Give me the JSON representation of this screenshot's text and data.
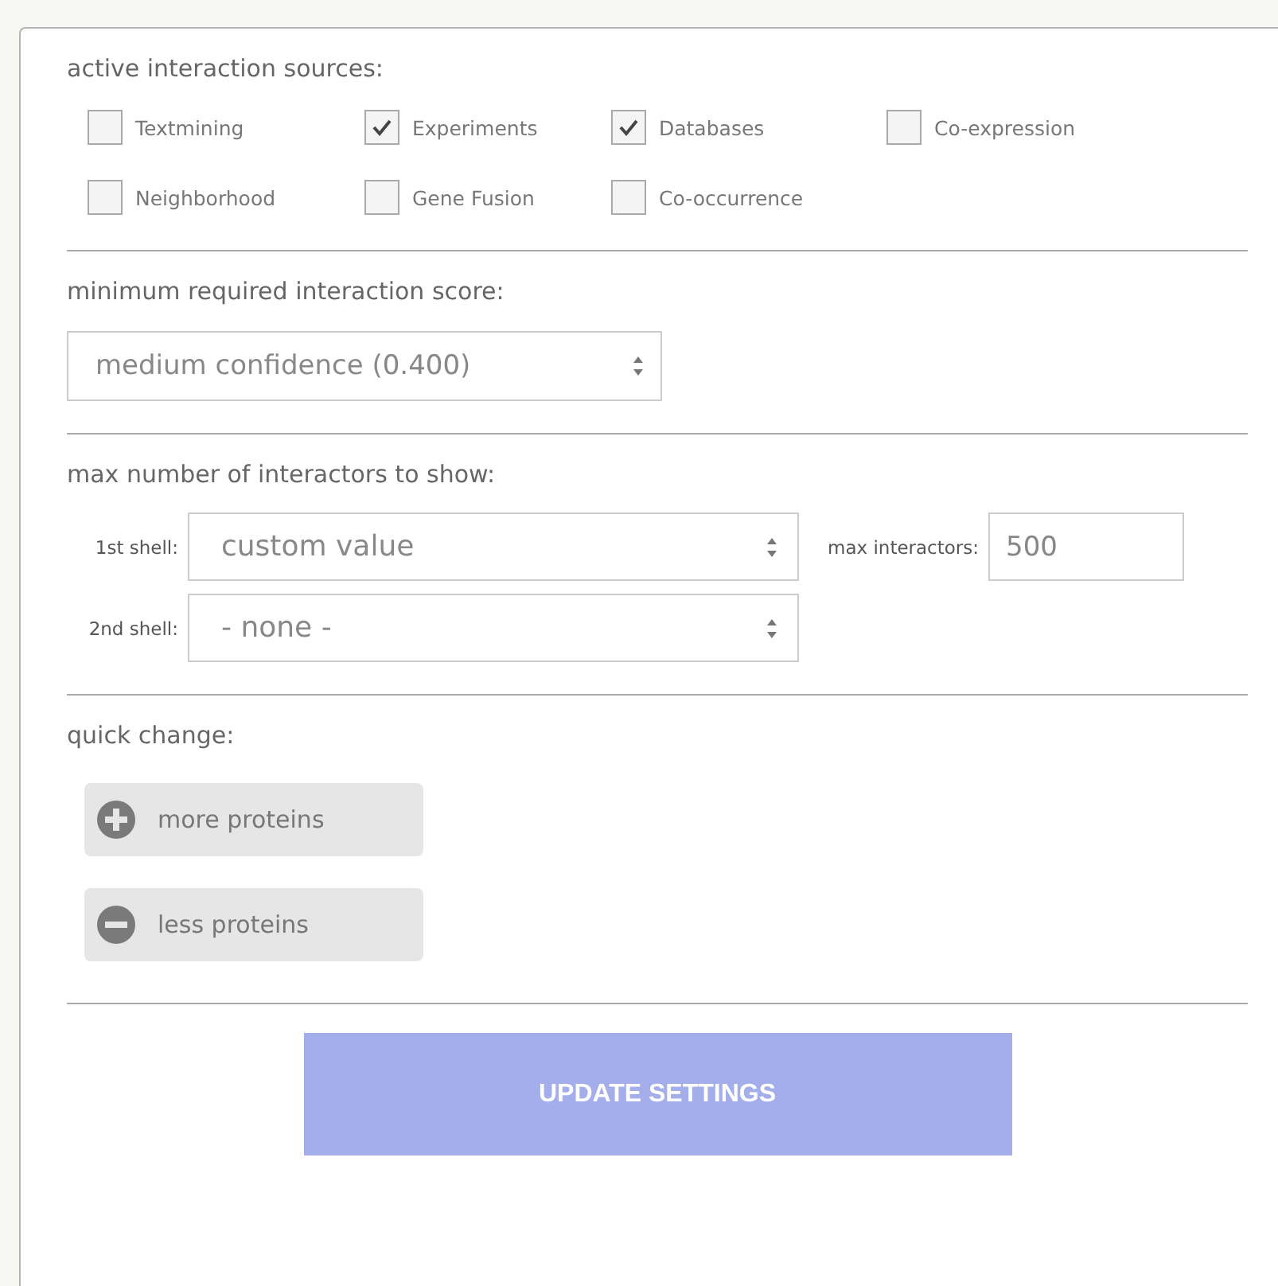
{
  "sources": {
    "heading": "active interaction sources:",
    "items": [
      {
        "label": "Textmining",
        "checked": false
      },
      {
        "label": "Experiments",
        "checked": true
      },
      {
        "label": "Databases",
        "checked": true
      },
      {
        "label": "Co-expression",
        "checked": false
      },
      {
        "label": "Neighborhood",
        "checked": false
      },
      {
        "label": "Gene Fusion",
        "checked": false
      },
      {
        "label": "Co-occurrence",
        "checked": false
      }
    ]
  },
  "score": {
    "heading": "minimum required interaction score:",
    "value": "medium confidence (0.400)"
  },
  "interactors": {
    "heading": "max number of interactors to show:",
    "shells": [
      {
        "label": "1st shell:",
        "value": "custom value"
      },
      {
        "label": "2nd shell:",
        "value": "- none -"
      }
    ],
    "max_label": "max interactors:",
    "max_value": "500"
  },
  "quick_change": {
    "heading": "quick change:",
    "buttons": [
      {
        "kind": "plus",
        "label": "more proteins"
      },
      {
        "kind": "minus",
        "label": "less proteins"
      }
    ]
  },
  "submit": "UPDATE SETTINGS"
}
